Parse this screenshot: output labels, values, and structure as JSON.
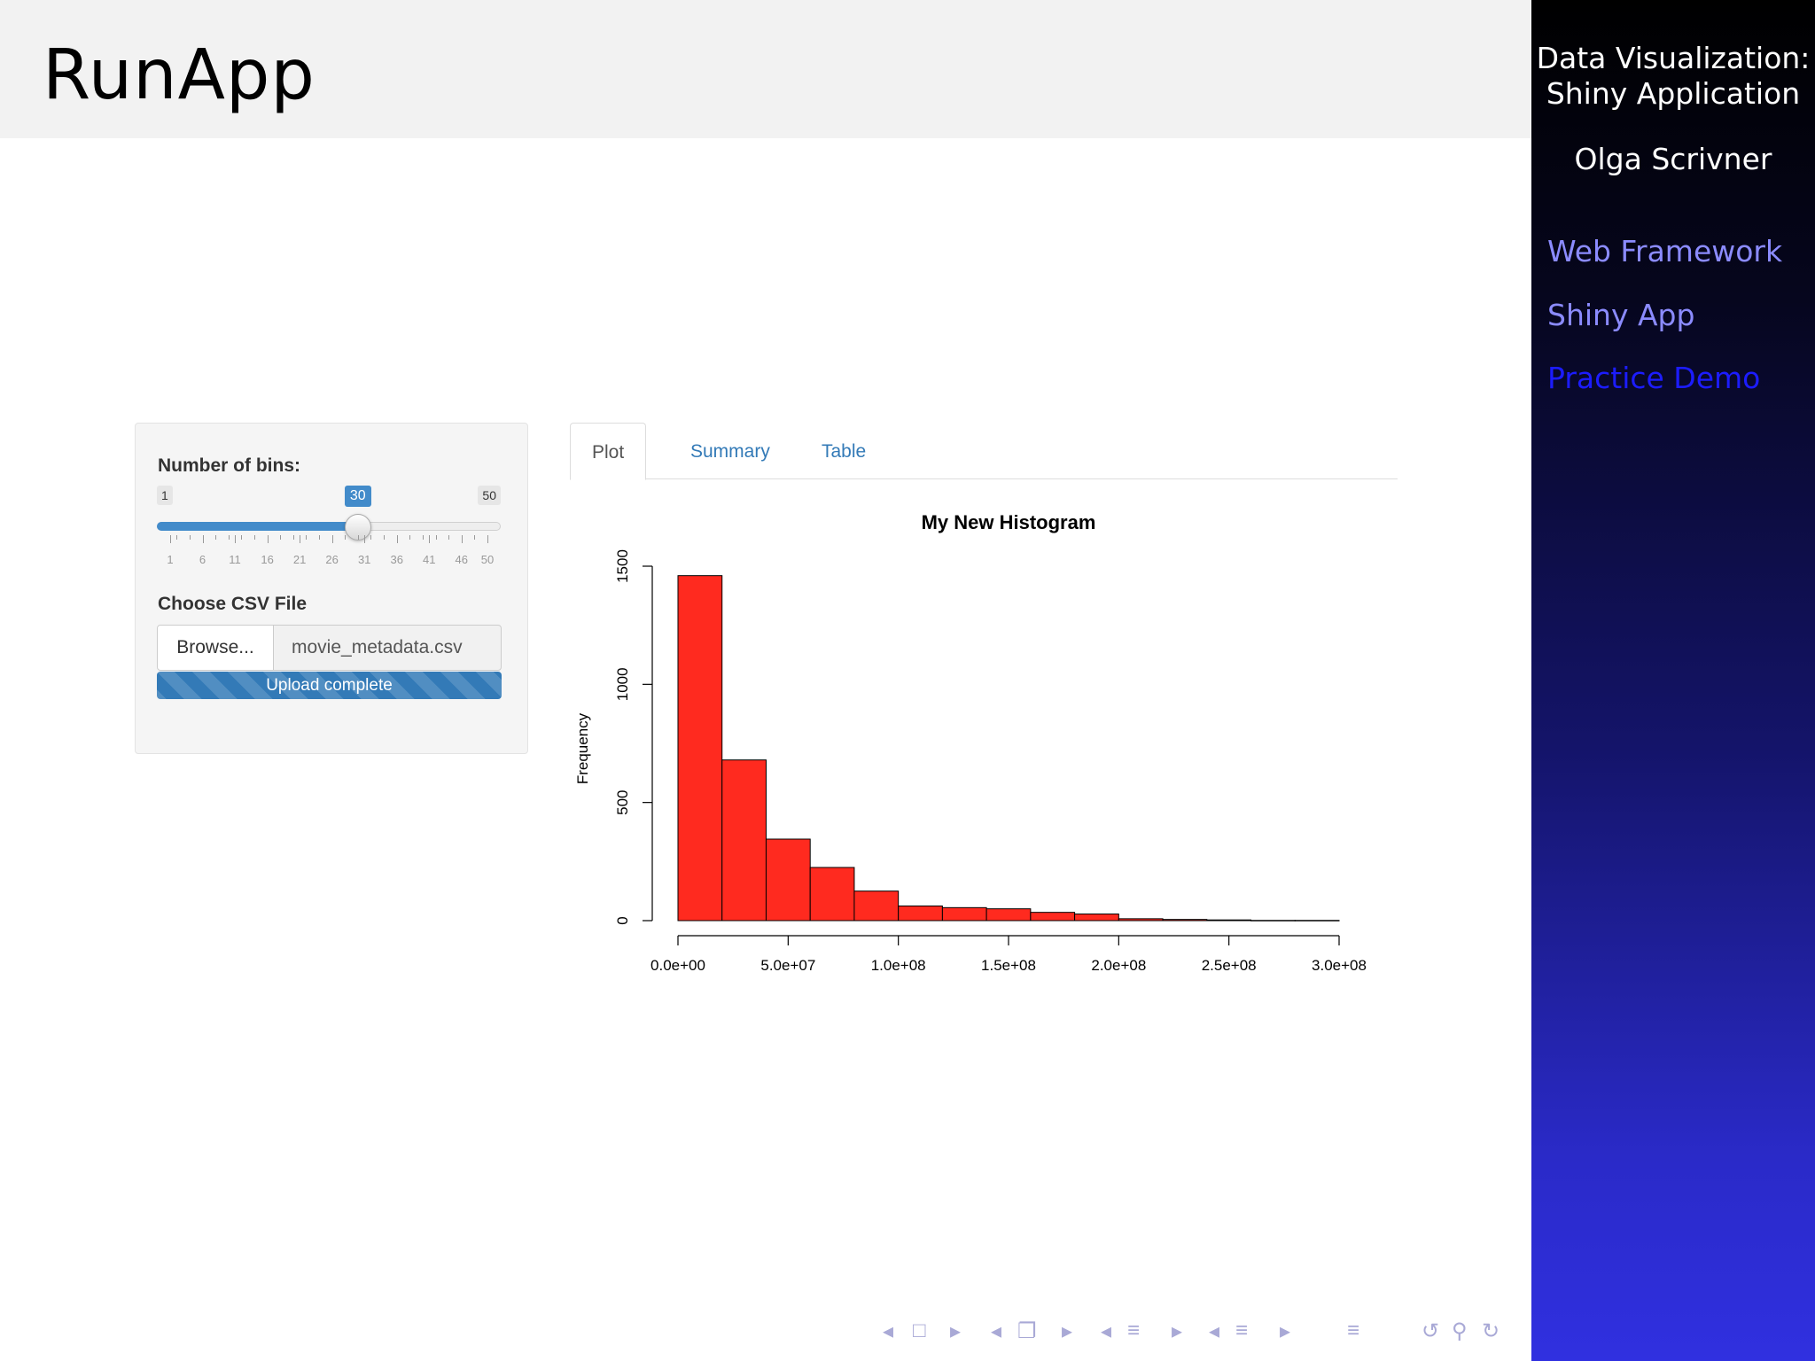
{
  "slide": {
    "title": "RunApp"
  },
  "sidebar": {
    "title_line1": "Data Visualization:",
    "title_line2": "Shiny Application",
    "author": "Olga Scrivner",
    "nav": [
      "Web Framework",
      "Shiny App",
      "Practice Demo"
    ]
  },
  "controls": {
    "bins_label": "Number of bins:",
    "slider": {
      "min": 1,
      "max": 50,
      "value": 30,
      "min_label": "1",
      "max_label": "50",
      "value_label": "30",
      "tick_labels": [
        "1",
        "6",
        "11",
        "16",
        "21",
        "26",
        "31",
        "36",
        "41",
        "46",
        "50"
      ]
    },
    "file_label": "Choose CSV File",
    "browse_label": "Browse...",
    "file_name": "movie_metadata.csv",
    "progress_text": "Upload complete"
  },
  "tabs": [
    "Plot",
    "Summary",
    "Table"
  ],
  "chart_data": {
    "type": "bar",
    "title": "My New Histogram",
    "xlabel": "",
    "ylabel": "Frequency",
    "bar_color": "#ff2a1f",
    "bin_edges": [
      0,
      20000000,
      40000000,
      60000000,
      80000000,
      100000000,
      120000000,
      140000000,
      160000000,
      180000000,
      200000000,
      220000000,
      240000000,
      260000000,
      280000000,
      300000000
    ],
    "values": [
      1460,
      680,
      345,
      225,
      125,
      62,
      55,
      50,
      35,
      28,
      8,
      5,
      3,
      1,
      1
    ],
    "xlim": [
      0,
      300000000
    ],
    "ylim": [
      0,
      1500
    ],
    "x_ticks": [
      "0.0e+00",
      "5.0e+07",
      "1.0e+08",
      "1.5e+08",
      "2.0e+08",
      "2.5e+08",
      "3.0e+08"
    ],
    "x_tick_values": [
      0,
      50000000,
      100000000,
      150000000,
      200000000,
      250000000,
      300000000
    ],
    "y_ticks": [
      "0",
      "500",
      "1000",
      "1500"
    ],
    "y_tick_values": [
      0,
      500,
      1000,
      1500
    ]
  }
}
